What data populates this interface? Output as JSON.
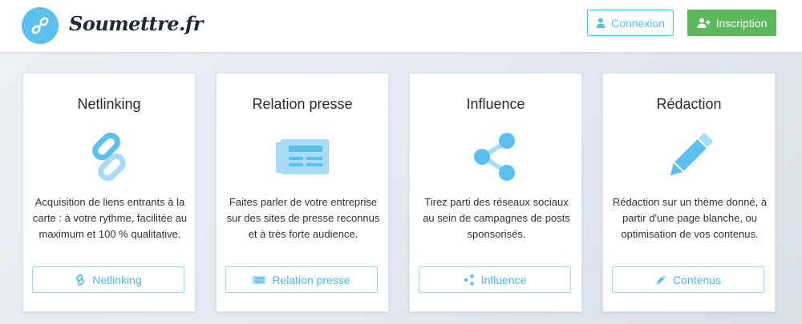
{
  "header": {
    "brand": "Soumettre.fr",
    "login_label": "Connexion",
    "signup_label": "Inscription"
  },
  "colors": {
    "accent": "#5bc0ee",
    "success": "#5cb85c",
    "text": "#333333"
  },
  "cards": [
    {
      "title": "Netlinking",
      "icon": "link-icon",
      "description": "Acquisition de liens entrants à la carte : à votre rythme, facilitée au maximum et 100 % qualitative.",
      "button_label": "Netlinking"
    },
    {
      "title": "Relation presse",
      "icon": "newspaper-icon",
      "description": "Faites parler de votre entreprise sur des sites de presse reconnus et à très forte audience.",
      "button_label": "Relation presse"
    },
    {
      "title": "Influence",
      "icon": "share-icon",
      "description": "Tirez parti des réseaux sociaux au sein de campagnes de posts sponsorisés.",
      "button_label": "Influence"
    },
    {
      "title": "Rédaction",
      "icon": "pencil-icon",
      "description": "Rédaction sur un thème donné, à partir d'une page blanche, ou optimisation de vos contenus.",
      "button_label": "Contenus"
    }
  ]
}
